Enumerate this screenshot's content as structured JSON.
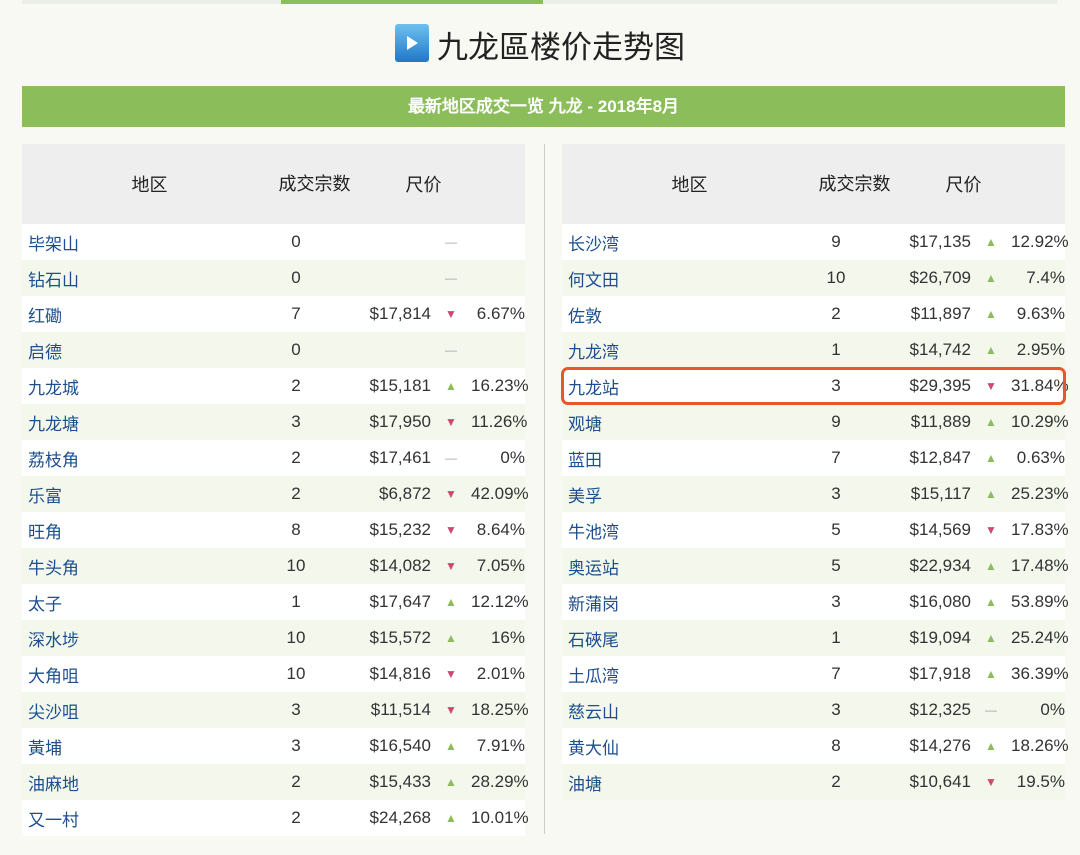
{
  "title": "九龙區楼价走势图",
  "banner": "最新地区成交一览 九龙 - 2018年8月",
  "headers": {
    "region": "地区",
    "count": "成交宗数",
    "price": "尺价"
  },
  "left": [
    [
      "毕架山",
      "0",
      "",
      "flat",
      ""
    ],
    [
      "钻石山",
      "0",
      "",
      "flat",
      ""
    ],
    [
      "红磡",
      "7",
      "$17,814",
      "down",
      "6.67%"
    ],
    [
      "启德",
      "0",
      "",
      "flat",
      ""
    ],
    [
      "九龙城",
      "2",
      "$15,181",
      "up",
      "16.23%"
    ],
    [
      "九龙塘",
      "3",
      "$17,950",
      "down",
      "11.26%"
    ],
    [
      "荔枝角",
      "2",
      "$17,461",
      "flat",
      "0%"
    ],
    [
      "乐富",
      "2",
      "$6,872",
      "down",
      "42.09%"
    ],
    [
      "旺角",
      "8",
      "$15,232",
      "down",
      "8.64%"
    ],
    [
      "牛头角",
      "10",
      "$14,082",
      "down",
      "7.05%"
    ],
    [
      "太子",
      "1",
      "$17,647",
      "up",
      "12.12%"
    ],
    [
      "深水埗",
      "10",
      "$15,572",
      "up",
      "16%"
    ],
    [
      "大角咀",
      "10",
      "$14,816",
      "down",
      "2.01%"
    ],
    [
      "尖沙咀",
      "3",
      "$11,514",
      "down",
      "18.25%"
    ],
    [
      "黃埔",
      "3",
      "$16,540",
      "up",
      "7.91%"
    ],
    [
      "油麻地",
      "2",
      "$15,433",
      "up",
      "28.29%"
    ],
    [
      "又一村",
      "2",
      "$24,268",
      "up",
      "10.01%"
    ]
  ],
  "right": [
    [
      "长沙湾",
      "9",
      "$17,135",
      "up",
      "12.92%"
    ],
    [
      "何文田",
      "10",
      "$26,709",
      "up",
      "7.4%"
    ],
    [
      "佐敦",
      "2",
      "$11,897",
      "up",
      "9.63%"
    ],
    [
      "九龙湾",
      "1",
      "$14,742",
      "up",
      "2.95%"
    ],
    [
      "九龙站",
      "3",
      "$29,395",
      "down",
      "31.84%"
    ],
    [
      "观塘",
      "9",
      "$11,889",
      "up",
      "10.29%"
    ],
    [
      "蓝田",
      "7",
      "$12,847",
      "up",
      "0.63%"
    ],
    [
      "美孚",
      "3",
      "$15,117",
      "up",
      "25.23%"
    ],
    [
      "牛池湾",
      "5",
      "$14,569",
      "down",
      "17.83%"
    ],
    [
      "奥运站",
      "5",
      "$22,934",
      "up",
      "17.48%"
    ],
    [
      "新蒲岗",
      "3",
      "$16,080",
      "up",
      "53.89%"
    ],
    [
      "石硤尾",
      "1",
      "$19,094",
      "up",
      "25.24%"
    ],
    [
      "土瓜湾",
      "7",
      "$17,918",
      "up",
      "36.39%"
    ],
    [
      "慈云山",
      "3",
      "$12,325",
      "flat",
      "0%"
    ],
    [
      "黄大仙",
      "8",
      "$14,276",
      "up",
      "18.26%"
    ],
    [
      "油塘",
      "2",
      "$10,641",
      "down",
      "19.5%"
    ]
  ],
  "highlighted_region": "九龙站",
  "colors": {
    "accent": "#8bbd5a",
    "down": "#d2476f",
    "highlight": "#e8572a"
  }
}
